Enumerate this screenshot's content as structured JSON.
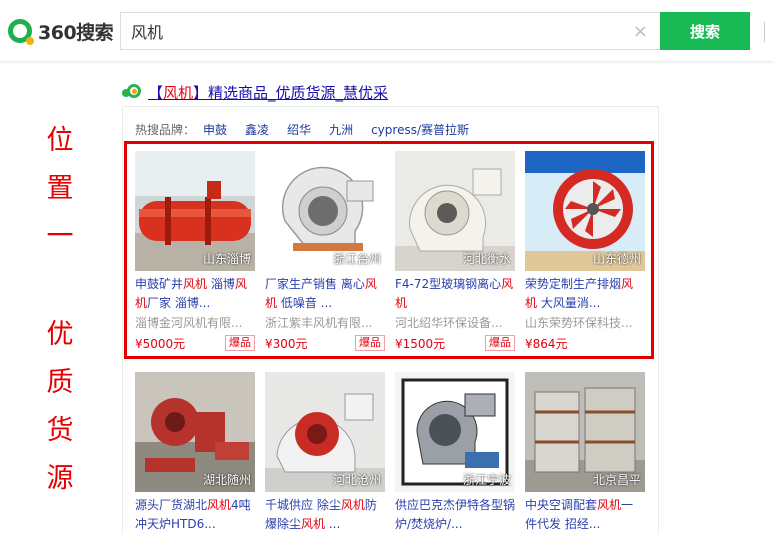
{
  "header": {
    "logo_text": "360搜索",
    "search_value": "风机",
    "clear_icon": "×",
    "search_button": "搜索"
  },
  "side_text": {
    "line1": [
      "位",
      "置",
      "一"
    ],
    "line2": [
      "优",
      "质",
      "货",
      "源"
    ]
  },
  "ad": {
    "title_prefix": "【",
    "title_keyword": "风机",
    "title_rest": "】精选商品_优质货源_慧优采"
  },
  "brands": {
    "label": "热搜品牌：",
    "items": [
      "申鼓",
      "鑫凌",
      "绍华",
      "九洲",
      "cypress/赛普拉斯"
    ]
  },
  "products_row1": [
    {
      "loc": "山东淄博",
      "t1": "申鼓矿井",
      "k1": "风机",
      "t2": " 淄博",
      "k2": "风机",
      "t3": "厂家 淄博...",
      "shop": "淄博金河风机有限...",
      "price": "¥5000元",
      "tag": "爆品"
    },
    {
      "loc": "浙江台州",
      "t1": "厂家生产销售 离心",
      "k1": "风机",
      "t2": " 低噪音 ...",
      "k2": "",
      "t3": "",
      "shop": "浙江紫丰风机有限...",
      "price": "¥300元",
      "tag": "爆品"
    },
    {
      "loc": "河北衡水",
      "t1": "F4-72型玻璃钢离心",
      "k1": "风机",
      "t2": "",
      "k2": "",
      "t3": "",
      "shop": "河北绍华环保设备...",
      "price": "¥1500元",
      "tag": "爆品"
    },
    {
      "loc": "山东德州",
      "t1": "荣势定制生产排烟",
      "k1": "风机",
      "t2": " 大风量消...",
      "k2": "",
      "t3": "",
      "shop": "山东荣势环保科技...",
      "price": "¥864元",
      "tag": ""
    }
  ],
  "products_row2": [
    {
      "loc": "湖北随州",
      "t1": "源头厂货湖北",
      "k1": "风机",
      "t2": "4吨冲天炉HTD6...",
      "k2": "",
      "t3": ""
    },
    {
      "loc": "河北沧州",
      "t1": "千城供应 除尘",
      "k1": "风机",
      "t2": "防爆除尘",
      "k2": "风机",
      "t3": " ..."
    },
    {
      "loc": "浙江宁波",
      "t1": "供应巴克杰伊特各型锅炉/焚烧炉/...",
      "k1": "",
      "t2": "",
      "k2": "",
      "t3": ""
    },
    {
      "loc": "北京昌平",
      "t1": "中央空调配套",
      "k1": "风机",
      "t2": "一件代发 招经...",
      "k2": "",
      "t3": ""
    }
  ],
  "colors": {
    "accent_green": "#19b955",
    "highlight_red": "#e40000",
    "link_blue": "#2a3fae"
  }
}
